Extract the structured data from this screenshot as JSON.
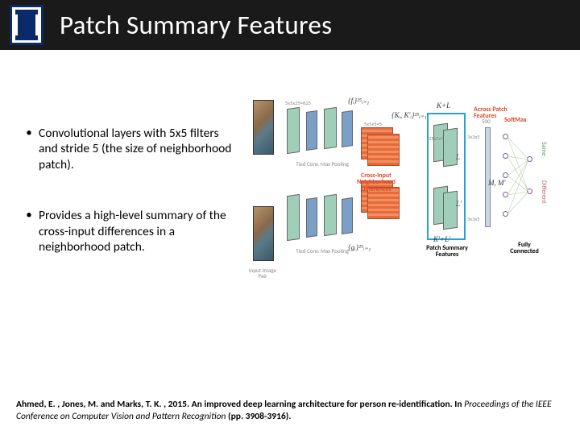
{
  "title": "Patch Summary Features",
  "bullets": [
    "Convolutional layers with 5x5 filters and stride 5 (the size of neighborhood patch).",
    "Provides a high-level summary of the cross-input differences in a neighborhood patch."
  ],
  "diagram": {
    "input_label": "Input Image Pair",
    "tied_label": "Tied Conv. Max Pooling",
    "diff_label": "Cross-Input Neighborhood Differences",
    "psf_label": "Patch Summary Features",
    "cross_patch_label": "Across Patch Features",
    "softmax_label": "SoftMax",
    "fc_label": "Fully Connected",
    "out_same": "Same",
    "out_diff": "Different",
    "num500": "500",
    "annot_fi": "{fᵢ}²⁵ᵢ₌₁",
    "annot_gi": "{gᵢ}²⁵ᵢ₌₁",
    "annot_ki1": "{Kᵢ, K'ᵢ}²⁵ᵢ₌₁",
    "annot_kl": "K+L",
    "annot_kl2": "K'+L'",
    "annot_l": "L",
    "annot_l2": "L'",
    "annot_m": "M, M'",
    "dim1": "5x5x25=625",
    "dim2": "5x5x5=5",
    "dim3": "3x3x5",
    "dim4": "25x5x5",
    "dim5": "25x5x5"
  },
  "citation": {
    "authors": "Ahmed, E. , Jones, M. and Marks, T. K. , 2015.",
    "title": "An improved deep learning architecture for person re-identification.",
    "venue": "Proceedings of the IEEE Conference on Computer Vision and Pattern Recognition",
    "pages": "(pp. 3908-3916)."
  }
}
